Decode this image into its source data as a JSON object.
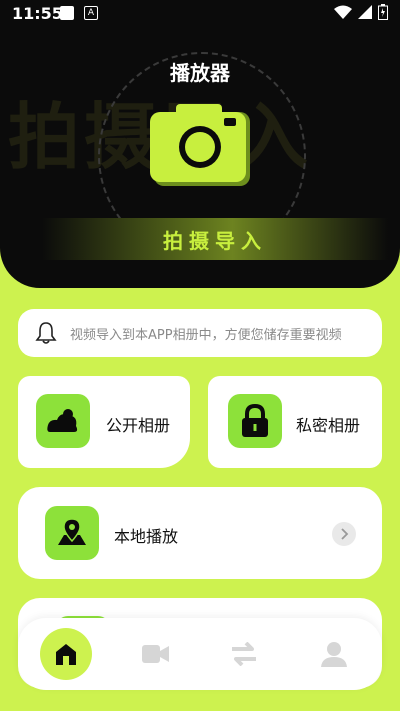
{
  "status_bar": {
    "time": "11:55",
    "badge": "A"
  },
  "header": {
    "title": "播放器",
    "watermark": "拍摄导入",
    "capture_label": "拍摄导入"
  },
  "notice": {
    "text": "视频导入到本APP相册中，方便您储存重要视频"
  },
  "cards": {
    "public_album": "公开相册",
    "private_album": "私密相册",
    "local_play": "本地播放"
  },
  "colors": {
    "accent": "#cdf24f",
    "icon_green": "#8de13a",
    "dark": "#0b0b0b"
  },
  "nav": {
    "items": [
      "home-icon",
      "video-icon",
      "transfer-icon",
      "user-icon"
    ],
    "active": "home-icon"
  }
}
